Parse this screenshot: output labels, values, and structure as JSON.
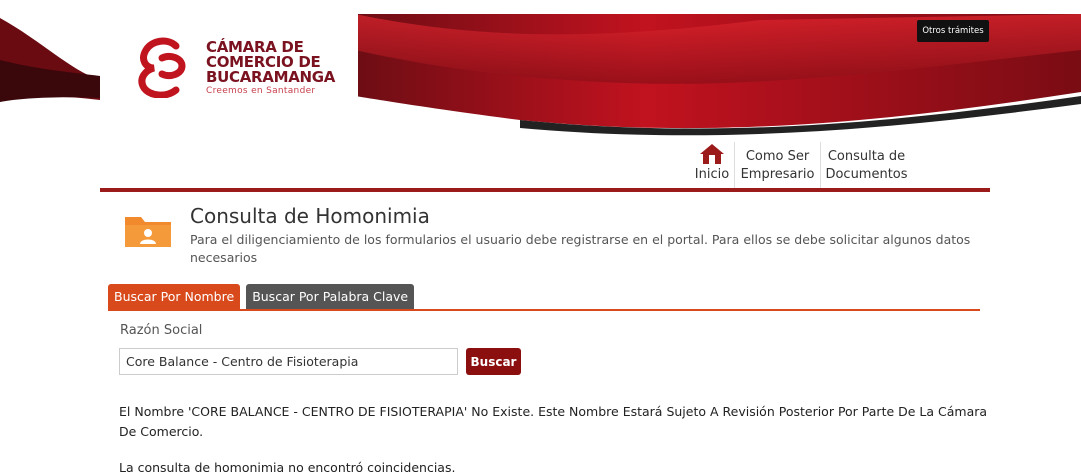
{
  "header": {
    "logo_line1": "CÁMARA DE",
    "logo_line2": "COMERCIO DE",
    "logo_line3": "BUCARAMANGA",
    "logo_tagline": "Creemos en Santander",
    "otros_tramites": "Otros trámites",
    "brand_color": "#9b1b1b"
  },
  "nav": {
    "home_label": "Inicio",
    "emp_line1": "Como Ser",
    "emp_line2": "Empresario",
    "doc_line1": "Consulta de",
    "doc_line2": "Documentos"
  },
  "page": {
    "title": "Consulta de Homonimia",
    "subtitle": "Para el diligenciamiento de los formularios el usuario debe registrarse en el portal. Para ellos se debe solicitar algunos datos necesarios"
  },
  "tabs": {
    "by_name": "Buscar Por Nombre",
    "by_keyword": "Buscar Por Palabra Clave",
    "active_color": "#d84a1b"
  },
  "form": {
    "label": "Razón Social",
    "value": "Core Balance - Centro de Fisioterapia",
    "button": "Buscar"
  },
  "results": {
    "message": "El Nombre 'CORE BALANCE - CENTRO DE FISIOTERAPIA' No Existe. Este Nombre Estará Sujeto A Revisión Posterior Por Parte De La Cámara De Comercio.",
    "no_match": "La consulta de homonimia no encontró coincidencias."
  }
}
